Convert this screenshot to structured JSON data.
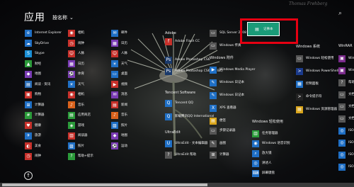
{
  "header": {
    "title": "应用",
    "sort": "按名称",
    "search": "⌕"
  },
  "watermark": "Thomas Frøhberg",
  "col1": [
    {
      "label": "Internet Explorer",
      "color": "#1f6fc5",
      "glyph": "e"
    },
    {
      "label": "SkyDrive",
      "color": "#1f6fc5",
      "glyph": "☁"
    },
    {
      "label": "Skype",
      "color": "#1a8fd6",
      "glyph": "S"
    },
    {
      "label": "财经",
      "color": "#2b9b3a",
      "glyph": "▲"
    },
    {
      "label": "地图",
      "color": "#7a3bb4",
      "glyph": "◆"
    },
    {
      "label": "阅读 · 资讯",
      "color": "#2d6fb8",
      "glyph": "▤"
    },
    {
      "label": "购物",
      "color": "#c8312b",
      "glyph": "▣"
    },
    {
      "label": "计算器",
      "color": "#1f6fc5",
      "glyph": "⊞"
    },
    {
      "label": "计算器",
      "color": "#2b9b3a",
      "glyph": "#"
    },
    {
      "label": "健康",
      "color": "#c8312b",
      "glyph": "♥"
    },
    {
      "label": "旅游",
      "color": "#1f6fc5",
      "glyph": "✈"
    },
    {
      "label": "美食",
      "color": "#c8312b",
      "glyph": "◐"
    },
    {
      "label": "闹钟",
      "color": "#c8312b",
      "glyph": "◷"
    }
  ],
  "col2": [
    {
      "label": "相机",
      "color": "#c8312b",
      "glyph": "◉"
    },
    {
      "label": "闹钟",
      "color": "#c8312b",
      "glyph": "◷"
    },
    {
      "label": "人脉",
      "color": "#c8312b",
      "glyph": "☺"
    },
    {
      "label": "日历",
      "color": "#7a3bb4",
      "glyph": "▦"
    },
    {
      "label": "体育",
      "color": "#7a3bb4",
      "glyph": "⚽"
    },
    {
      "label": "天气",
      "color": "#1f6fc5",
      "glyph": "☀"
    },
    {
      "label": "相机",
      "color": "#c8312b",
      "glyph": "◉"
    },
    {
      "label": "音乐",
      "color": "#d9621c",
      "glyph": "♪"
    },
    {
      "label": "应用商店",
      "color": "#2b9b3a",
      "glyph": "▤"
    },
    {
      "label": "游戏",
      "color": "#2b9b3a",
      "glyph": "◈"
    },
    {
      "label": "阅读器",
      "color": "#c8312b",
      "glyph": "▥"
    },
    {
      "label": "照片",
      "color": "#1f6fc5",
      "glyph": "▨"
    },
    {
      "label": "帮助+提示",
      "color": "#2b9b3a",
      "glyph": "?"
    }
  ],
  "col3": [
    {
      "label": "邮件",
      "color": "#1f6fc5",
      "glyph": "✉"
    },
    {
      "label": "日历",
      "color": "#7a3bb4",
      "glyph": "▦"
    },
    {
      "label": "人脉",
      "color": "#c8312b",
      "glyph": "☺"
    },
    {
      "label": "天气",
      "color": "#1f6fc5",
      "glyph": "☀"
    },
    {
      "label": "桌面",
      "color": "#1f6fc5",
      "glyph": "▭"
    },
    {
      "label": "视频",
      "color": "#c8312b",
      "glyph": "▶"
    },
    {
      "label": "消息",
      "color": "#7a3bb4",
      "glyph": "✉"
    },
    {
      "label": "新闻",
      "color": "#c8312b",
      "glyph": "▤"
    },
    {
      "label": "音乐",
      "color": "#d9621c",
      "glyph": "♪"
    },
    {
      "label": "照片",
      "color": "#1f6fc5",
      "glyph": "▨"
    },
    {
      "label": "地图",
      "color": "#7a3bb4",
      "glyph": "◆"
    },
    {
      "label": "运动",
      "color": "#7a3bb4",
      "glyph": "⚽"
    }
  ],
  "col4": {
    "groups": [
      {
        "label": "Adobe"
      },
      {
        "label": "Tencent Software"
      },
      {
        "label": "UltraEdit"
      }
    ],
    "apps": [
      {
        "label": "Adobe Flash CC",
        "color": "#c8312b",
        "glyph": "f"
      },
      {
        "label": "Adobe Photoshop CS6",
        "color": "#1a3a6b",
        "glyph": "Ps"
      },
      {
        "label": "Adobe Photoshop CS6 (64 Bit)",
        "color": "#1a3a6b",
        "glyph": "Ps"
      },
      {
        "label": "Tencent QQ",
        "color": "#1f6fc5",
        "glyph": "Q"
      },
      {
        "label": "卸载腾讯QQ International",
        "color": "#1f6fc5",
        "glyph": "Q"
      },
      {
        "label": "UltraEdit · 文本编辑器",
        "color": "#1f6fc5",
        "glyph": "U"
      },
      {
        "label": "UltraEdit 帮助",
        "color": "#555555",
        "glyph": "?"
      }
    ]
  },
  "col5": {
    "groups": [
      {
        "label": "Windows 附件"
      },
      {
        "label": "Windows 轻松使用"
      }
    ],
    "apps": [
      {
        "label": "SQL Server 2008",
        "color": "#555555",
        "glyph": "▭"
      },
      {
        "label": "Windows 传真",
        "color": "#555555",
        "glyph": "▭"
      },
      {
        "label": "Windows Media Player",
        "color": "#1f6fc5",
        "glyph": "▶"
      },
      {
        "label": "Windows 日记本",
        "color": "#1f6fc5",
        "glyph": "✎"
      },
      {
        "label": "Windows 日记本",
        "color": "#1f6fc5",
        "glyph": "✎"
      },
      {
        "label": "XPS 查看器",
        "color": "#1f6fc5",
        "glyph": "X"
      },
      {
        "label": "便签",
        "color": "#d9a51c",
        "glyph": "▤"
      },
      {
        "label": "步骤记录器",
        "color": "#555555",
        "glyph": "▭"
      },
      {
        "label": "画图",
        "color": "#555555",
        "glyph": "✎"
      },
      {
        "label": "计算器",
        "color": "#555555",
        "glyph": "⊞"
      }
    ]
  },
  "col6": {
    "groups": [
      {
        "label": "Windows 系统"
      }
    ],
    "apps": [
      {
        "label": "记事本",
        "color": "#1a9b78",
        "glyph": "▤",
        "selected": true
      },
      {
        "label": "Windows 轻松使用",
        "color": "#555555",
        "glyph": "▭"
      },
      {
        "label": "Windows PowerShell",
        "color": "#1a3a8b",
        "glyph": ">"
      },
      {
        "label": "控制面板",
        "color": "#1f6fc5",
        "glyph": "▦"
      },
      {
        "label": "命令提示符",
        "color": "#222222",
        "glyph": ">"
      },
      {
        "label": "Windows 资源管理器",
        "color": "#d9a51c",
        "glyph": "▤"
      },
      {
        "label": "任务管理器",
        "color": "#2b9b3a",
        "glyph": "▥"
      },
      {
        "label": "Windows 语音识别",
        "color": "#1f6fc5",
        "glyph": "◉"
      },
      {
        "label": "放大镜",
        "color": "#1f6fc5",
        "glyph": "⌕"
      },
      {
        "label": "讲述人",
        "color": "#1f6fc5",
        "glyph": "◎"
      },
      {
        "label": "屏幕键盘",
        "color": "#1f6fc5",
        "glyph": "⌨"
      }
    ]
  },
  "col7": [
    {
      "label": "WinRAR",
      "color": "#7a2b8b",
      "glyph": "▣"
    },
    {
      "label": "WinRAR",
      "color": "#7a2b8b",
      "glyph": "▣"
    },
    {
      "label": "帮助",
      "color": "#555555",
      "glyph": "?"
    },
    {
      "label": "文档",
      "color": "#555555",
      "glyph": "▭"
    },
    {
      "label": "文档",
      "color": "#555555",
      "glyph": "▭"
    },
    {
      "label": "文档",
      "color": "#555555",
      "glyph": "▭"
    },
    {
      "label": "ISO",
      "color": "#1f6fc5",
      "glyph": "◎"
    },
    {
      "label": "ISO",
      "color": "#1f6fc5",
      "glyph": "◎"
    },
    {
      "label": "ISO",
      "color": "#1f6fc5",
      "glyph": "◎"
    },
    {
      "label": "ISO",
      "color": "#1f6fc5",
      "glyph": "◎"
    }
  ],
  "col7group": "WinRAR",
  "footer": {
    "up_arrow": "↑"
  }
}
